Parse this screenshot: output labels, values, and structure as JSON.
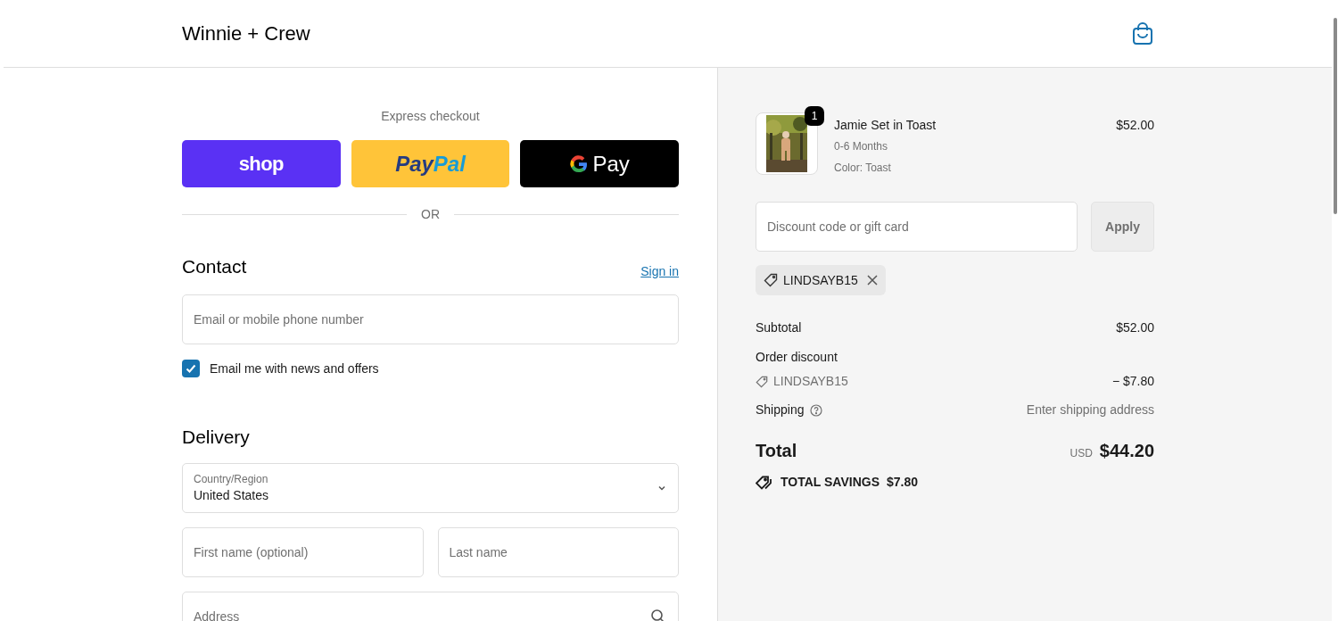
{
  "header": {
    "store_name": "Winnie + Crew"
  },
  "express_checkout": {
    "title": "Express checkout",
    "buttons": [
      {
        "kind": "shop",
        "parts": [
          "shop"
        ]
      },
      {
        "kind": "paypal",
        "parts": [
          "Pay",
          "Pal"
        ]
      },
      {
        "kind": "gpay",
        "parts": [
          "Pay"
        ]
      }
    ],
    "divider": "OR"
  },
  "contact": {
    "heading": "Contact",
    "sign_in": "Sign in",
    "email_placeholder": "Email or mobile phone number",
    "newsletter": {
      "label": "Email me with news and offers",
      "checked": true
    }
  },
  "delivery": {
    "heading": "Delivery",
    "country": {
      "label": "Country/Region",
      "value": "United States"
    },
    "first_name_placeholder": "First name (optional)",
    "last_name_placeholder": "Last name",
    "address_placeholder": "Address"
  },
  "summary": {
    "items": [
      {
        "name": "Jamie Set in Toast",
        "quantity": "1",
        "variant": "0-6 Months",
        "color_label": "Color: Toast",
        "price": "$52.00"
      }
    ],
    "discount": {
      "placeholder": "Discount code or gift card",
      "apply": "Apply",
      "codes": [
        "LINDSAYB15"
      ]
    },
    "subtotal": {
      "label": "Subtotal",
      "value": "$52.00"
    },
    "order_discount": {
      "label": "Order discount",
      "code": "LINDSAYB15",
      "value": "− $7.80"
    },
    "shipping": {
      "label": "Shipping",
      "value": "Enter shipping address"
    },
    "total": {
      "label": "Total",
      "currency": "USD",
      "value": "$44.20"
    },
    "savings": {
      "label": "TOTAL SAVINGS",
      "value": "$7.80"
    }
  }
}
